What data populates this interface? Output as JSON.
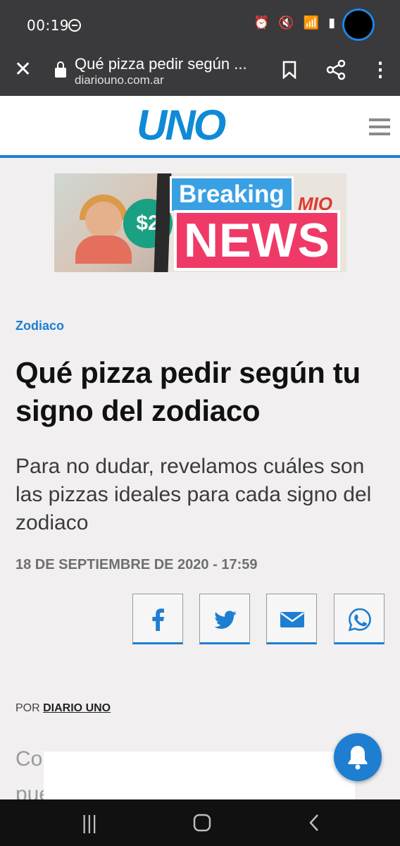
{
  "status_bar": {
    "time": "00:19",
    "icons": "⏰ 🔇 📶 ▮"
  },
  "browser": {
    "page_title": "Qué pizza pedir según ...",
    "domain": "diariouno.com.ar"
  },
  "site": {
    "logo": "UNO"
  },
  "ad": {
    "price_text": "$2",
    "brand": "MIO",
    "breaking": "Breaking",
    "news": "NEWS"
  },
  "article": {
    "category": "Zodiaco",
    "title": "Qué pizza pedir según tu signo del zodiaco",
    "subtitle": "Para no dudar, revelamos cuáles son las pizzas ideales para cada signo del zodiaco",
    "date": "18 DE SEPTIEMBRE DE 2020 - 17:59",
    "byline_prefix": "POR",
    "byline_author": "DIARIO UNO",
    "body_preview_line1": "Co",
    "body_preview_line2": "pue"
  },
  "share_buttons": [
    {
      "icon": "facebook-icon"
    },
    {
      "icon": "twitter-icon"
    },
    {
      "icon": "email-icon"
    },
    {
      "icon": "whatsapp-icon"
    }
  ],
  "colors": {
    "brand_blue": "#1e7ed2",
    "chrome_gray": "#3a3a3c",
    "page_bg": "#f1eff0"
  }
}
